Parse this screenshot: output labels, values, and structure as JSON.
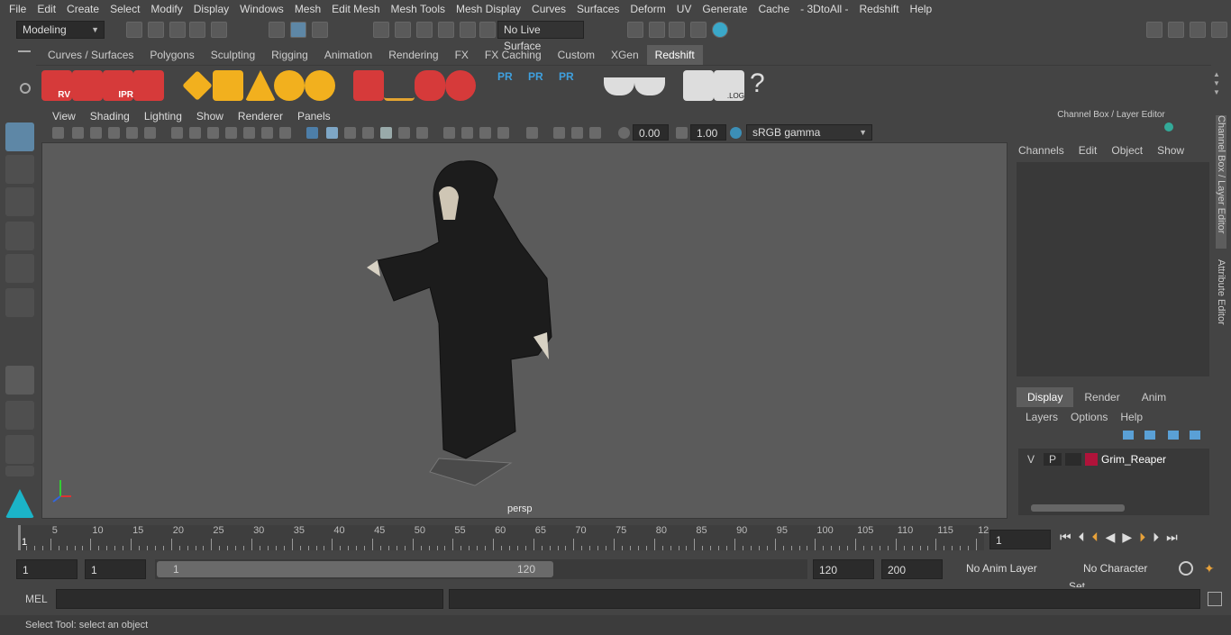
{
  "menubar": {
    "items": [
      "File",
      "Edit",
      "Create",
      "Select",
      "Modify",
      "Display",
      "Windows",
      "Mesh",
      "Edit Mesh",
      "Mesh Tools",
      "Mesh Display",
      "Curves",
      "Surfaces",
      "Deform",
      "UV",
      "Generate",
      "Cache",
      "- 3DtoAll -",
      "Redshift",
      "Help"
    ]
  },
  "status": {
    "workspace": "Modeling",
    "live_surface": "No Live Surface"
  },
  "shelf": {
    "tabs": [
      "Curves / Surfaces",
      "Polygons",
      "Sculpting",
      "Rigging",
      "Animation",
      "Rendering",
      "FX",
      "FX Caching",
      "Custom",
      "XGen",
      "Redshift"
    ],
    "active_tab": "Redshift",
    "icon_labels": [
      "RV",
      "IPR",
      "PR",
      "PR",
      "PR",
      ".LOG",
      "?"
    ]
  },
  "viewport": {
    "menus": [
      "View",
      "Shading",
      "Lighting",
      "Show",
      "Renderer",
      "Panels"
    ],
    "exposure": "0.00",
    "gamma": "1.00",
    "color_space": "sRGB gamma",
    "camera": "persp"
  },
  "channel_box": {
    "title": "Channel Box / Layer Editor",
    "menus": [
      "Channels",
      "Edit",
      "Object",
      "Show"
    ],
    "layer_tabs": [
      "Display",
      "Render",
      "Anim"
    ],
    "active_layer_tab": "Display",
    "layer_menus": [
      "Layers",
      "Options",
      "Help"
    ],
    "layer": {
      "v": "V",
      "p": "P",
      "name": "Grim_Reaper",
      "color": "#b0133a"
    }
  },
  "side_tabs": [
    "Channel Box / Layer Editor",
    "Attribute Editor"
  ],
  "timeline": {
    "ticks": [
      "5",
      "10",
      "15",
      "20",
      "25",
      "30",
      "35",
      "40",
      "45",
      "50",
      "55",
      "60",
      "65",
      "70",
      "75",
      "80",
      "85",
      "90",
      "95",
      "100",
      "105",
      "110",
      "115",
      "12"
    ],
    "start_label": "1",
    "current_frame": "1"
  },
  "range": {
    "start": "1",
    "start2": "1",
    "slider_start": "1",
    "slider_end": "120",
    "end": "120",
    "end2": "200",
    "anim_layer": "No Anim Layer",
    "char_set": "No Character Set"
  },
  "cmd": {
    "label": "MEL"
  },
  "help": {
    "text": "Select Tool: select an object"
  }
}
